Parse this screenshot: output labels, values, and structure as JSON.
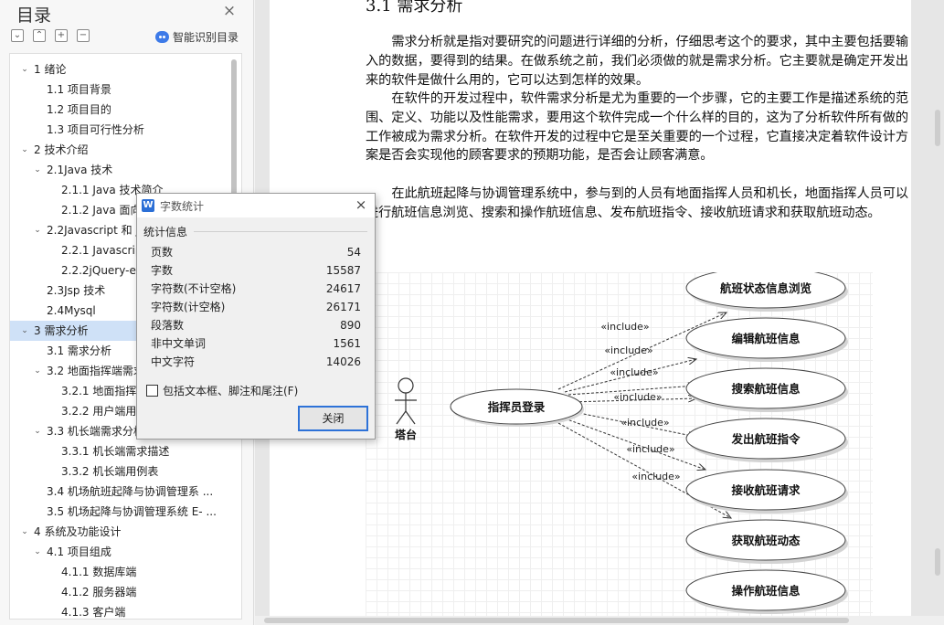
{
  "nav": {
    "title": "目录",
    "close": "×",
    "toolbar": {
      "collapse": "⌄",
      "expand": "⌃",
      "add": "+",
      "remove": "−"
    },
    "smart_toc": "智能识别目录",
    "items": [
      {
        "label": "1   绪论",
        "level": 1,
        "caret": "⌄"
      },
      {
        "label": "1.1  项目背景",
        "level": 2,
        "caret": ""
      },
      {
        "label": "1.2  项目目的",
        "level": 2,
        "caret": ""
      },
      {
        "label": "1.3  项目可行性分析",
        "level": 2,
        "caret": ""
      },
      {
        "label": "2   技术介绍",
        "level": 1,
        "caret": "⌄"
      },
      {
        "label": "2.1Java 技术",
        "level": 2,
        "caret": "⌄"
      },
      {
        "label": "2.1.1 Java 技术简介",
        "level": 3,
        "caret": ""
      },
      {
        "label": "2.1.2 Java 面向",
        "level": 3,
        "caret": ""
      },
      {
        "label": "2.2Javascript 和 jQ",
        "level": 2,
        "caret": "⌄"
      },
      {
        "label": "2.2.1 Javascript",
        "level": 3,
        "caret": ""
      },
      {
        "label": "2.2.2jQuery-ea",
        "level": 3,
        "caret": ""
      },
      {
        "label": "2.3Jsp 技术",
        "level": 2,
        "caret": ""
      },
      {
        "label": "2.4Mysql",
        "level": 2,
        "caret": ""
      },
      {
        "label": "3   需求分析",
        "level": 1,
        "caret": "⌄"
      },
      {
        "label": "3.1 需求分析",
        "level": 2,
        "caret": ""
      },
      {
        "label": "3.2  地面指挥端需求",
        "level": 2,
        "caret": "⌄"
      },
      {
        "label": "3.2.1 地面指挥端",
        "level": 3,
        "caret": ""
      },
      {
        "label": "3.2.2 用户端用例",
        "level": 3,
        "caret": ""
      },
      {
        "label": "3.3 机长端需求分析",
        "level": 2,
        "caret": "⌄"
      },
      {
        "label": "3.3.1 机长端需求描述",
        "level": 3,
        "caret": ""
      },
      {
        "label": "3.3.2 机长端用例表",
        "level": 3,
        "caret": ""
      },
      {
        "label": "3.4 机场航班起降与协调管理系 ...",
        "level": 2,
        "caret": ""
      },
      {
        "label": "3.5 机场起降与协调管理系统 E- ...",
        "level": 2,
        "caret": ""
      },
      {
        "label": "4   系统及功能设计",
        "level": 1,
        "caret": "⌄"
      },
      {
        "label": "4.1  项目组成",
        "level": 2,
        "caret": "⌄"
      },
      {
        "label": "4.1.1  数据库端",
        "level": 3,
        "caret": ""
      },
      {
        "label": "4.1.2  服务器端",
        "level": 3,
        "caret": ""
      },
      {
        "label": "4.1.3  客户端",
        "level": 3,
        "caret": ""
      }
    ],
    "selected_index": 13
  },
  "document": {
    "heading": "3.1 需求分析",
    "paragraphs": [
      "需求分析就是指对要研究的问题进行详细的分析，仔细思考这个的要求，其中主要包括要输入的数据，要得到的结果。在做系统之前，我们必须做的就是需求分析。它主要就是确定开发出来的软件是做什么用的，它可以达到怎样的效果。",
      "在软件的开发过程中，软件需求分析是尤为重要的一个步骤，它的主要工作是描述系统的范围、定义、功能以及性能需求，要用这个软件完成一个什么样的目的，这为了分析软件所有做的工作被成为需求分析。在软件开发的过程中它是至关重要的一个过程，它直接决定着软件设计方案是否会实现他的顾客要求的预期功能，是否会让顾客满意。",
      "在此航班起降与协调管理系统中，参与到的人员有地面指挥人员和机长，地面指挥人员可以进行航班信息浏览、搜索和操作航班信息、发布航班指令、接收航班请求和获取航班动态。"
    ]
  },
  "diagram": {
    "actor": "塔台",
    "center": "指挥员登录",
    "include_label": "«include»",
    "use_cases": [
      "航班状态信息浏览",
      "编辑航班信息",
      "搜索航班信息",
      "发出航班指令",
      "接收航班请求",
      "获取航班动态",
      "操作航班信息"
    ]
  },
  "dialog": {
    "title": "字数统计",
    "icon": "W",
    "close": "×",
    "section": "统计信息",
    "stats": [
      {
        "label": "页数",
        "value": "54"
      },
      {
        "label": "字数",
        "value": "15587"
      },
      {
        "label": "字符数(不计空格)",
        "value": "24617"
      },
      {
        "label": "字符数(计空格)",
        "value": "26171"
      },
      {
        "label": "段落数",
        "value": "890"
      },
      {
        "label": "非中文单词",
        "value": "1561"
      },
      {
        "label": "中文字符",
        "value": "14026"
      }
    ],
    "checkbox_label": "包括文本框、脚注和尾注(F)",
    "ok": "关闭"
  }
}
